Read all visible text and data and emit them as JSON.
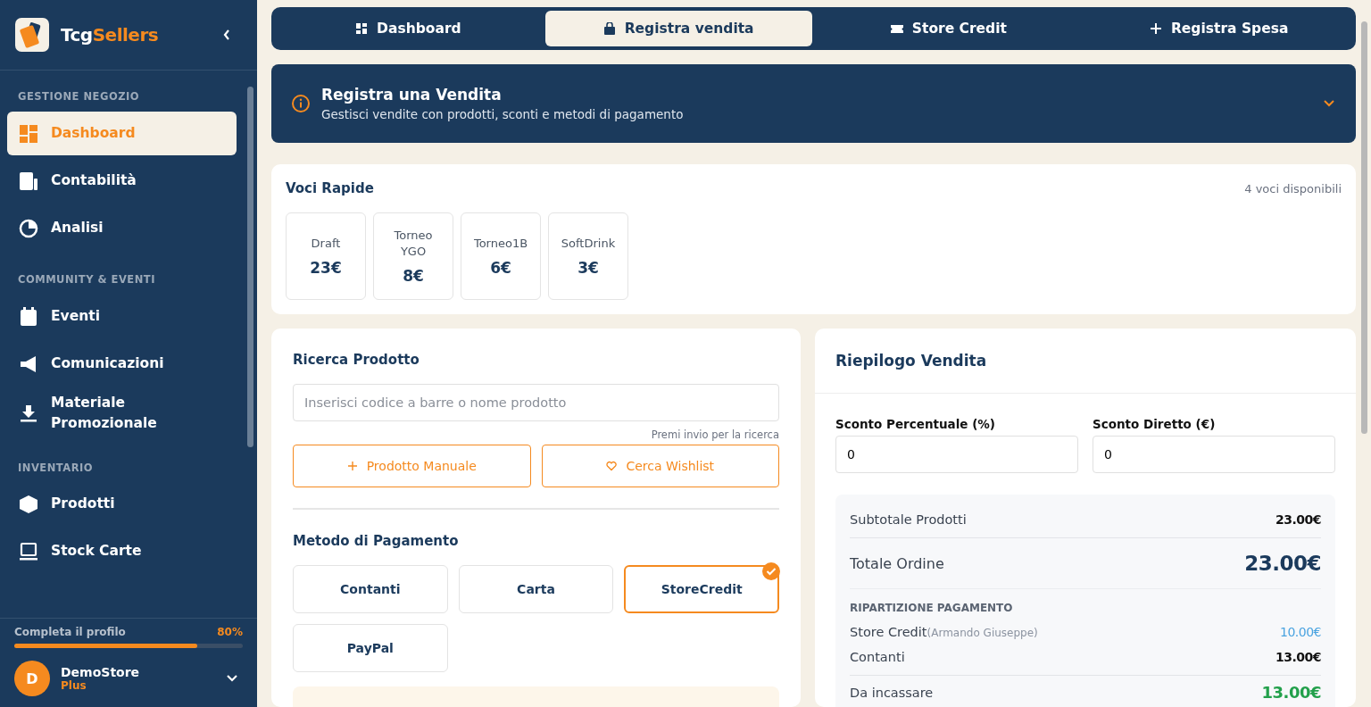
{
  "sidebar": {
    "brand": {
      "part_1": "Tcg",
      "part_2": "Sellers"
    },
    "sections": [
      {
        "title": "GESTIONE NEGOZIO",
        "items": [
          {
            "label": "Dashboard",
            "selected": true
          },
          {
            "label": "Contabilità",
            "selected": false
          },
          {
            "label": "Analisi",
            "selected": false
          }
        ]
      },
      {
        "title": "COMMUNITY & EVENTI",
        "items": [
          {
            "label": "Eventi",
            "selected": false
          },
          {
            "label": "Comunicazioni",
            "selected": false
          },
          {
            "label": "Materiale Promozionale",
            "selected": false
          }
        ]
      },
      {
        "title": "INVENTARIO",
        "items": [
          {
            "label": "Prodotti",
            "selected": false
          },
          {
            "label": "Stock Carte",
            "selected": false
          }
        ]
      }
    ],
    "profile_progress": {
      "label": "Completa il profilo",
      "reading": "80%",
      "level": 0.8
    },
    "user": {
      "initial": "D",
      "name": "DemoStore",
      "plan": "Plus"
    }
  },
  "tabs": [
    {
      "label": "Dashboard",
      "selected": false
    },
    {
      "label": "Registra vendita",
      "selected": true
    },
    {
      "label": "Store Credit",
      "selected": false
    },
    {
      "label": "Registra Spesa",
      "selected": false
    }
  ],
  "banner": {
    "title": "Registra una Vendita",
    "subtitle": "Gestisci vendite con prodotti, sconti e metodi di pagamento"
  },
  "quick_items": {
    "title": "Voci Rapide",
    "count": "4 voci disponibili",
    "items": [
      {
        "name": "Draft",
        "price": "23€"
      },
      {
        "name": "Torneo YGO",
        "price": "8€"
      },
      {
        "name": "Torneo1B",
        "price": "6€"
      },
      {
        "name": "SoftDrink",
        "price": "3€"
      }
    ]
  },
  "product_search": {
    "title": "Ricerca Prodotto",
    "placeholder": "Inserisci codice a barre o nome prodotto",
    "hint": "Premi invio per la ricerca",
    "buttons": [
      {
        "label": "Prodotto Manuale"
      },
      {
        "label": "Cerca Wishlist"
      }
    ]
  },
  "payment": {
    "title": "Metodo di Pagamento",
    "methods": [
      {
        "label": "Contanti",
        "selected": false
      },
      {
        "label": "Carta",
        "selected": false
      },
      {
        "label": "StoreCredit",
        "selected": true
      },
      {
        "label": "PayPal",
        "selected": false
      }
    ]
  },
  "summary": {
    "title": "Riepilogo Vendita",
    "discount_percent": {
      "label": "Sconto Percentuale (%)",
      "value": "0"
    },
    "discount_direct": {
      "label": "Sconto Diretto (€)",
      "value": "0"
    },
    "subtotal": {
      "label": "Subtotale Prodotti",
      "value": "23.00€"
    },
    "total": {
      "label": "Totale Ordine",
      "value": "23.00€"
    },
    "breakdown_title": "RIPARTIZIONE PAGAMENTO",
    "breakdown": [
      {
        "label": "Store Credit",
        "note": "(Armando Giuseppe)",
        "value": "10.00€",
        "kind": "credit"
      },
      {
        "label": "Contanti",
        "value": "13.00€",
        "kind": "cash"
      }
    ],
    "due": {
      "label": "Da incassare",
      "value": "13.00€"
    }
  }
}
